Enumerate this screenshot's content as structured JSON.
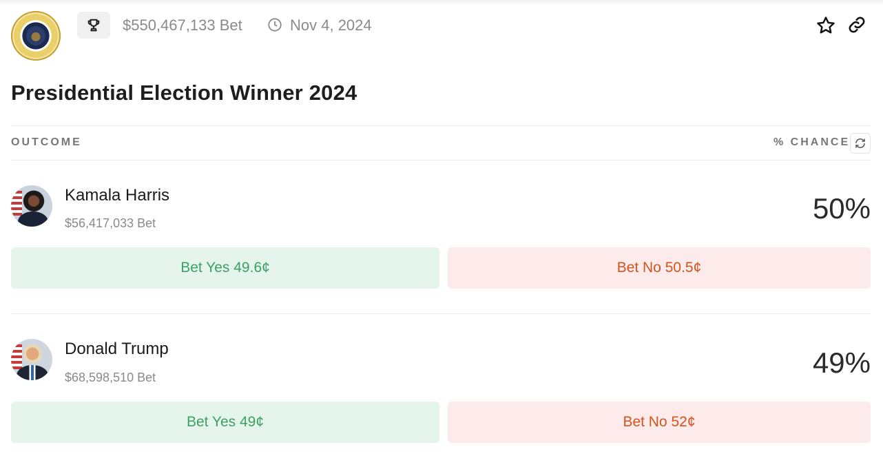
{
  "header": {
    "volume": "$550,467,133 Bet",
    "end_date": "Nov 4, 2024"
  },
  "market": {
    "title": "Presidential Election Winner 2024"
  },
  "columns": {
    "outcome": "OUTCOME",
    "chance": "% CHANCE"
  },
  "outcomes": [
    {
      "name": "Kamala Harris",
      "volume": "$56,417,033 Bet",
      "chance": "50%",
      "bet_yes": "Bet Yes 49.6¢",
      "bet_no": "Bet No 50.5¢"
    },
    {
      "name": "Donald Trump",
      "volume": "$68,598,510 Bet",
      "chance": "49%",
      "bet_yes": "Bet Yes 49¢",
      "bet_no": "Bet No 52¢"
    }
  ],
  "icons": {
    "seal": "presidential-seal-icon",
    "trophy": "trophy-icon",
    "clock": "clock-icon",
    "star": "star-icon",
    "link": "link-icon",
    "refresh": "refresh-icon"
  },
  "colors": {
    "yes_bg": "#e6f5ec",
    "yes_text": "#3ca064",
    "no_bg": "#fdeaea",
    "no_text": "#d4541e",
    "muted_text": "#8a8a8a"
  }
}
